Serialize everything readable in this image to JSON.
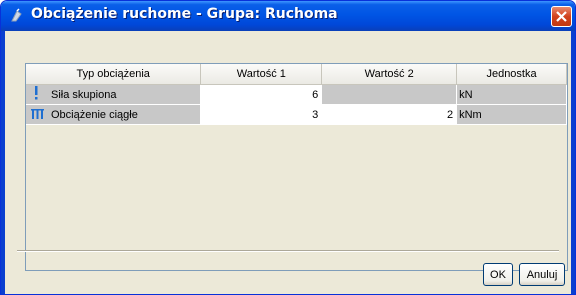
{
  "window": {
    "title": "Obciążenie ruchome - Grupa: Ruchoma"
  },
  "table": {
    "columns": [
      "Typ obciążenia",
      "Wartość 1",
      "Wartość 2",
      "Jednostka"
    ],
    "rows": [
      {
        "icon": "point-load-icon",
        "type": "Siła skupiona",
        "value1": "6",
        "value2": "",
        "unit": "kN"
      },
      {
        "icon": "distributed-load-icon",
        "type": "Obciążenie ciągłe",
        "value1": "3",
        "value2": "2",
        "unit": "kNm"
      }
    ]
  },
  "buttons": {
    "ok": "OK",
    "cancel": "Anuluj"
  },
  "colors": {
    "titlebar": "#0055e5",
    "close": "#d1421d",
    "row_gray": "#c8c8c8",
    "icon_blue": "#1f6fd1"
  }
}
